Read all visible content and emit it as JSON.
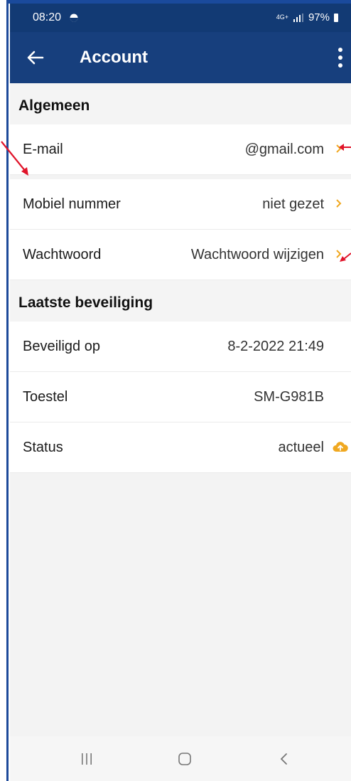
{
  "status_bar": {
    "time": "08:20",
    "battery": "97%",
    "network": "4G+"
  },
  "app_bar": {
    "title": "Account"
  },
  "sections": [
    {
      "title": "Algemeen",
      "rows": [
        {
          "label": "E-mail",
          "value": "@gmail.com",
          "chevron": true
        },
        {
          "label": "Mobiel nummer",
          "value": "niet gezet",
          "chevron": true
        },
        {
          "label": "Wachtwoord",
          "value": "Wachtwoord wijzigen",
          "chevron": true
        }
      ]
    },
    {
      "title": "Laatste beveiliging",
      "rows": [
        {
          "label": "Beveiligd op",
          "value": "8-2-2022 21:49"
        },
        {
          "label": "Toestel",
          "value": "SM-G981B"
        },
        {
          "label": "Status",
          "value": "actueel",
          "icon": "cloud-upload-icon"
        }
      ]
    }
  ],
  "colors": {
    "app_bar": "#173f7d",
    "status_bar": "#123a74",
    "accent": "#f0a820",
    "annotation": "#e0142a"
  }
}
